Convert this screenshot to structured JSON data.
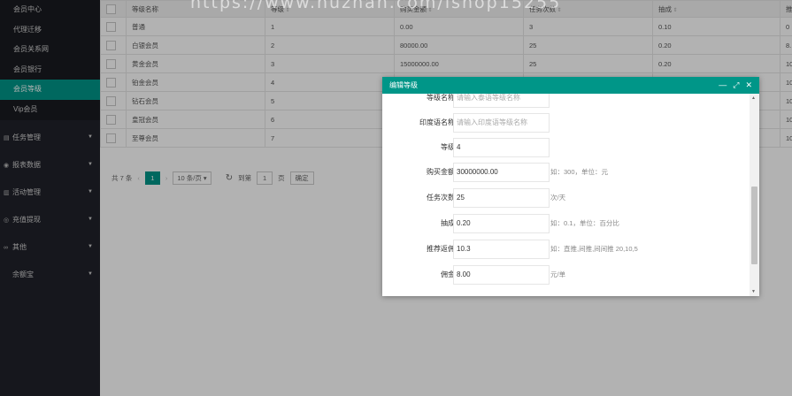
{
  "sidebar": {
    "sub_items": [
      {
        "label": "会员中心",
        "active": false
      },
      {
        "label": "代理迁移",
        "active": false
      },
      {
        "label": "会员关系网",
        "active": false
      },
      {
        "label": "会员银行",
        "active": false
      },
      {
        "label": "会员等级",
        "active": true
      },
      {
        "label": "Vip会员",
        "active": false
      }
    ],
    "groups": [
      {
        "label": "任务管理",
        "icon": "clipboard-icon",
        "glyph": "▤"
      },
      {
        "label": "报表数据",
        "icon": "chart-icon",
        "glyph": "◉"
      },
      {
        "label": "活动管理",
        "icon": "book-icon",
        "glyph": "▥"
      },
      {
        "label": "充值提现",
        "icon": "coin-icon",
        "glyph": "◎"
      },
      {
        "label": "其他",
        "icon": "link-icon",
        "glyph": "∞"
      },
      {
        "label": "余额宝",
        "icon": "",
        "glyph": ""
      }
    ]
  },
  "table": {
    "headers": [
      "等级名称",
      "等级",
      "购买金额",
      "任务次数",
      "抽成",
      "推"
    ],
    "rows": [
      [
        "普通",
        "1",
        "0.00",
        "3",
        "0.10",
        "0"
      ],
      [
        "白银会员",
        "2",
        "80000.00",
        "25",
        "0.20",
        "8."
      ],
      [
        "黄金会员",
        "3",
        "15000000.00",
        "25",
        "0.20",
        "10"
      ],
      [
        "铂金会员",
        "4",
        "",
        "",
        "",
        "10"
      ],
      [
        "钻石会员",
        "5",
        "",
        "",
        "",
        "10"
      ],
      [
        "皇冠会员",
        "6",
        "",
        "",
        "",
        "10"
      ],
      [
        "至尊会员",
        "7",
        "",
        "",
        "",
        "10"
      ]
    ]
  },
  "pager": {
    "total": "共 7 条",
    "prev": "‹",
    "current": "1",
    "next": "›",
    "page_size": "10 条/页 ▾",
    "goto_label": "到第",
    "goto_value": "1",
    "page_unit": "页",
    "confirm": "确定"
  },
  "watermark": "https://www.huzhan.com/ishop15255",
  "dialog": {
    "title": "编辑等级",
    "controls": [
      "—",
      "⤢",
      "✕"
    ],
    "fields": [
      {
        "label": "等级名称",
        "value": "请输入泰语等级名称",
        "placeholder": true,
        "hint": ""
      },
      {
        "label": "印度语名称",
        "value": "请输入印度语等级名称",
        "placeholder": true,
        "hint": ""
      },
      {
        "label": "等级",
        "value": "4",
        "placeholder": false,
        "hint": ""
      },
      {
        "label": "购买金额",
        "value": "30000000.00",
        "placeholder": false,
        "hint": "如：300，单位：元"
      },
      {
        "label": "任务次数",
        "value": "25",
        "placeholder": false,
        "hint": "次/天"
      },
      {
        "label": "抽成",
        "value": "0.20",
        "placeholder": false,
        "hint": "如：0.1，单位：百分比"
      },
      {
        "label": "推荐返佣",
        "value": "10.3",
        "placeholder": false,
        "hint": "如：直推,间推,间间推 20,10,5"
      },
      {
        "label": "佣金",
        "value": "8.00",
        "placeholder": false,
        "hint": "元/单"
      }
    ]
  }
}
